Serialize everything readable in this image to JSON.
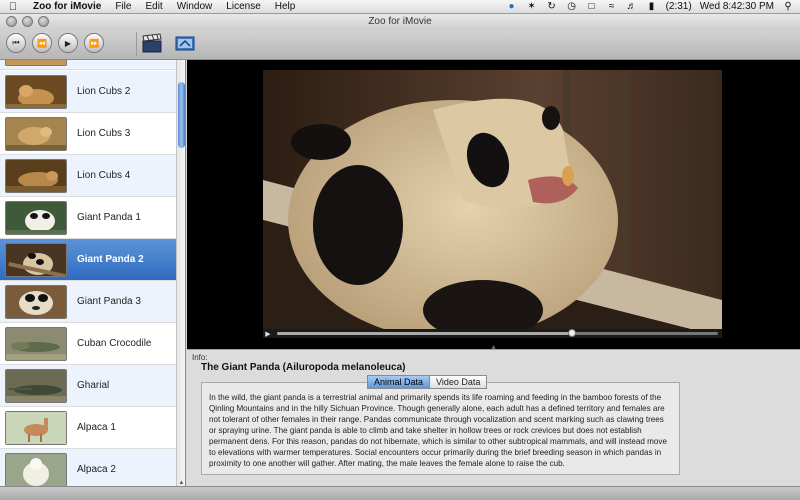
{
  "menubar": {
    "app_name": "Zoo for iMovie",
    "menus": [
      "File",
      "Edit",
      "Window",
      "License",
      "Help"
    ],
    "battery": "(2:31)",
    "clock": "Wed 8:42:30 PM"
  },
  "window": {
    "title": "Zoo for iMovie"
  },
  "toolbar": {
    "buttons": [
      "skip-back",
      "rewind",
      "play",
      "fast-forward"
    ]
  },
  "clips": [
    {
      "label": "Lion Cubs 2",
      "selected": false
    },
    {
      "label": "Lion Cubs 3",
      "selected": false
    },
    {
      "label": "Lion Cubs 4",
      "selected": false
    },
    {
      "label": "Giant Panda 1",
      "selected": false
    },
    {
      "label": "Giant Panda 2",
      "selected": true
    },
    {
      "label": "Giant Panda 3",
      "selected": false
    },
    {
      "label": "Cuban Crocodile",
      "selected": false
    },
    {
      "label": "Gharial",
      "selected": false
    },
    {
      "label": "Alpaca 1",
      "selected": false
    },
    {
      "label": "Alpaca 2",
      "selected": false
    }
  ],
  "player": {
    "progress": 0.67
  },
  "info": {
    "caption": "Info:",
    "species": "The Giant Panda (Ailuropoda melanoleuca)",
    "tabs": [
      {
        "label": "Animal Data",
        "active": true
      },
      {
        "label": "Video Data",
        "active": false
      }
    ],
    "description": "In the wild, the giant panda is a terrestrial animal and primarily spends its life roaming and feeding in the bamboo forests of the Qinling Mountains and in the hilly Sichuan Province. Though generally alone, each adult has a defined territory and females are not tolerant of other females in their range. Pandas communicate through vocalization and scent marking such as clawing trees or spraying urine. The giant panda is able to climb and take shelter in hollow trees or rock crevices but does not establish permanent dens. For this reason, pandas do not hibernate, which is similar to other subtropical mammals, and will instead move to elevations with warmer temperatures. Social encounters occur primarily during the brief breeding season in which pandas in proximity to one another will gather. After mating, the male leaves the female alone to raise the cub."
  },
  "colors": {
    "selection": "#2f6bc1",
    "active_tab": "#5e97dc"
  }
}
